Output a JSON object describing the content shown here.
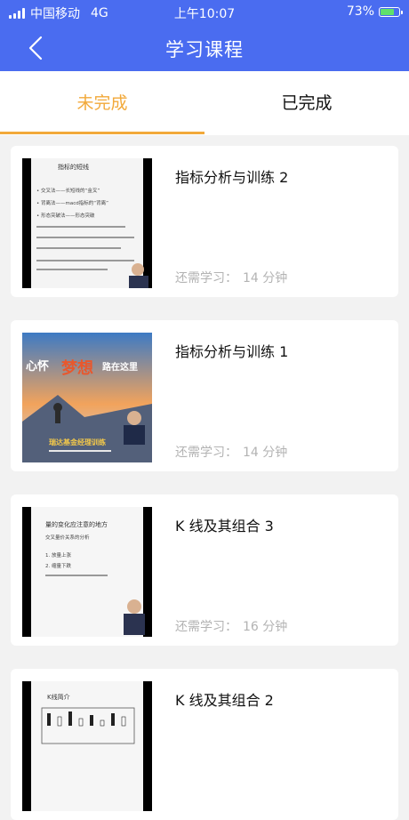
{
  "status_bar": {
    "carrier": "中国移动",
    "network": "4G",
    "time": "上午10:07",
    "battery_text": "73%",
    "battery_level": 0.73
  },
  "header": {
    "title": "学习课程",
    "back_icon": "chevron-left-icon"
  },
  "tabs": [
    {
      "label": "未完成"
    },
    {
      "label": "已完成"
    }
  ],
  "colors": {
    "primary": "#4a6cf0",
    "accent": "#f2a93a"
  },
  "courses": [
    {
      "title": "指标分析与训练 2",
      "remaining_label": "还需学习：",
      "remaining_value": "14 分钟"
    },
    {
      "title": "指标分析与训练 1",
      "remaining_label": "还需学习：",
      "remaining_value": "14 分钟"
    },
    {
      "title": "K 线及其组合 3",
      "remaining_label": "还需学习：",
      "remaining_value": "16 分钟"
    },
    {
      "title": "K 线及其组合 2"
    }
  ],
  "thumbnails": {
    "course1_lines": [
      "指标的短线",
      "• 交叉法——长短线的“金叉”",
      "• 背离法——macd指标的“背离”",
      "• 形态突破法——形态突破"
    ],
    "course2_banner_left": "心怀",
    "course2_banner_mid": "梦想",
    "course2_banner_right": "路在这里",
    "course2_footer": "瑞达基金经理训练",
    "course3_lines": [
      "量的变化应注意的地方",
      "交叉量价关系的分析",
      "1. 放量上涨",
      "2. 缩量下跌"
    ],
    "course4_heading": "K线简介"
  }
}
